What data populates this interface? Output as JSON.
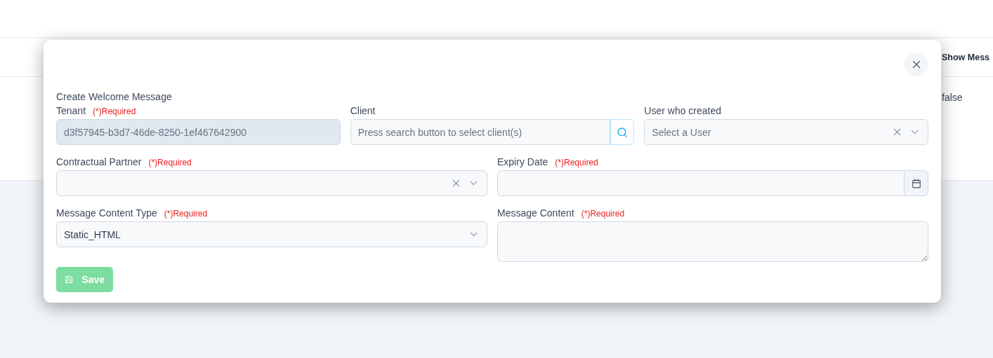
{
  "background_table": {
    "header": "Show Mess",
    "cell": "false"
  },
  "dialog": {
    "title": "Create Welcome Message",
    "rows": [
      {
        "fields": [
          {
            "kind": "text",
            "label": "Tenant",
            "required_note": "(*)Required",
            "value": "d3f57945-b3d7-46de-8250-1ef467642900",
            "disabled": true
          },
          {
            "kind": "search",
            "label": "Client",
            "placeholder": "Press search button to select client(s)"
          },
          {
            "kind": "select",
            "label": "User who created",
            "placeholder": "Select a User",
            "clearable": true
          }
        ]
      },
      {
        "fields": [
          {
            "kind": "select",
            "label": "Contractual Partner",
            "required_note": "(*)Required",
            "clearable": true
          },
          {
            "kind": "date",
            "label": "Expiry Date",
            "required_note": "(*)Required"
          }
        ]
      },
      {
        "fields": [
          {
            "kind": "select",
            "label": "Message Content Type",
            "required_note": "(*)Required",
            "value": "Static_HTML",
            "clearable": false
          },
          {
            "kind": "textarea",
            "label": "Message Content",
            "required_note": "(*)Required"
          }
        ]
      }
    ],
    "save": {
      "label": "Save",
      "disabled": true
    }
  }
}
